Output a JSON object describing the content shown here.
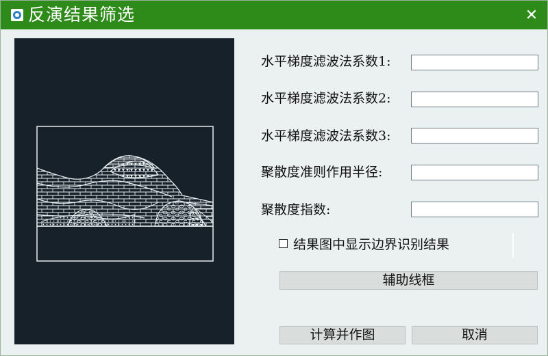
{
  "window": {
    "title": "反演结果筛选",
    "close_glyph": "✕",
    "icon": "app-icon"
  },
  "fields": [
    {
      "label": "水平梯度滤波法系数1:",
      "value": ""
    },
    {
      "label": "水平梯度滤波法系数2:",
      "value": ""
    },
    {
      "label": "水平梯度滤波法系数3:",
      "value": ""
    },
    {
      "label": "聚散度准则作用半径:",
      "value": ""
    },
    {
      "label": "聚散度指数:",
      "value": ""
    }
  ],
  "checkbox": {
    "label": "结果图中显示边界识别结果",
    "checked": false
  },
  "buttons": {
    "aux_frame": "辅助线框",
    "compute_plot": "计算并作图",
    "cancel": "取消"
  },
  "colors": {
    "titlebar": "#2e8b1a",
    "background": "#eaf1f0",
    "preview_bg": "#16212a",
    "button": "#d9dedd"
  }
}
